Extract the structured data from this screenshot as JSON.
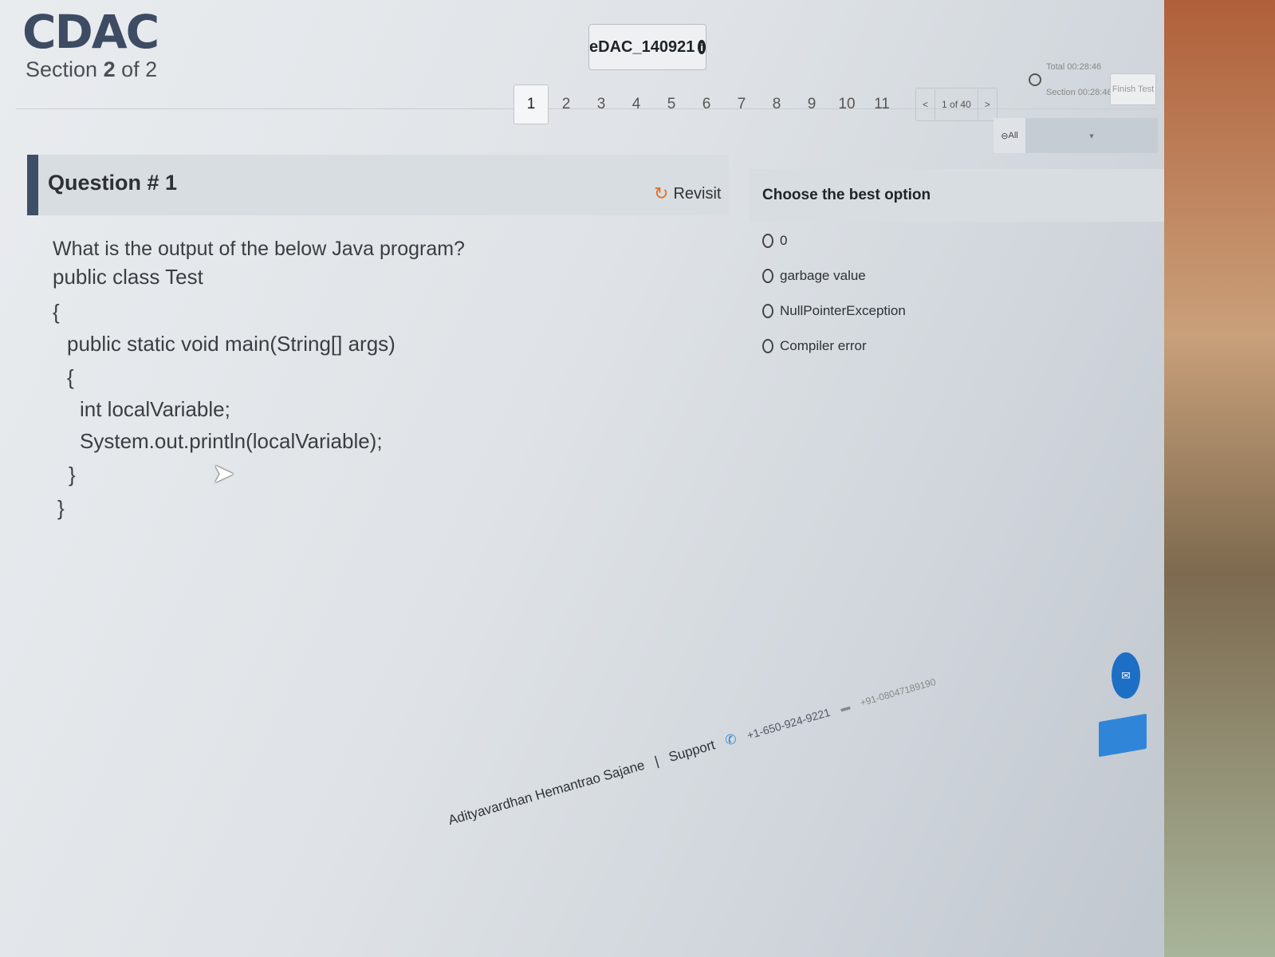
{
  "header": {
    "logo": "CDAC",
    "section_prefix": "Section",
    "section_current": "2",
    "section_suffix": "of 2",
    "exam_id": "eDAC_140921",
    "info_icon": "info-icon",
    "timer_total": "Total 00:28:46",
    "timer_section": "Section 00:28:46",
    "finish_label": "Finish Test"
  },
  "pagination": {
    "pages": [
      "1",
      "2",
      "3",
      "4",
      "5",
      "6",
      "7",
      "8",
      "9",
      "10",
      "11"
    ],
    "active_page": "1",
    "prev_label": "<",
    "count_label": "1 of 40",
    "next_label": ">",
    "filter_label": "All"
  },
  "question": {
    "title": "Question # 1",
    "revisit_label": "Revisit",
    "prompt": "What is the output of the below Java program?",
    "code": [
      "public class Test",
      "{",
      "public static void main(String[] args)",
      "{",
      "int localVariable;",
      "System.out.println(localVariable);",
      "}",
      "}"
    ]
  },
  "options": {
    "title": "Choose the best option",
    "items": [
      "0",
      "garbage value",
      "NullPointerException",
      "Compiler error"
    ]
  },
  "footer": {
    "user": "Adityavardhan Hemantrao Sajane",
    "separator": "|",
    "support_label": "Support",
    "phone_us": "+1-650-924-9221",
    "phone_in": "+91-08047189190"
  },
  "colors": {
    "accent": "#3d4f66",
    "revisit": "#e0702a",
    "primary_button": "#2f86d8"
  }
}
